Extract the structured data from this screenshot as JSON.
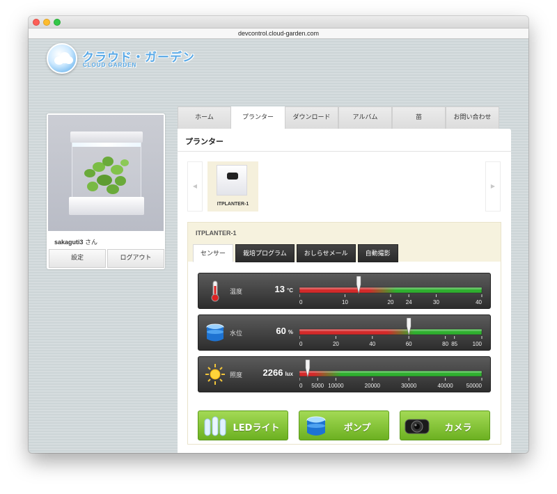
{
  "browser": {
    "url": "devcontrol.cloud-garden.com"
  },
  "logo": {
    "jp": "クラウド・ガーデン",
    "en": "CLOUD GARDEN"
  },
  "sidebar": {
    "username": "sakaguti3",
    "honorific": "さん",
    "settings_label": "設定",
    "logout_label": "ログアウト"
  },
  "nav": {
    "tabs": [
      {
        "label": "ホーム"
      },
      {
        "label": "プランター"
      },
      {
        "label": "ダウンロード"
      },
      {
        "label": "アルバム"
      },
      {
        "label": "苗"
      },
      {
        "label": "お問い合わせ"
      }
    ],
    "active": "プランター"
  },
  "panel": {
    "title": "プランター",
    "prev_arrow": "◀",
    "next_arrow": "▶",
    "planter_thumb_label": "ITPLANTER-1"
  },
  "device": {
    "name": "ITPLANTER-1",
    "subtabs": [
      {
        "label": "センサー"
      },
      {
        "label": "栽培プログラム"
      },
      {
        "label": "おしらせメール"
      },
      {
        "label": "自動撮影"
      }
    ],
    "sensors": [
      {
        "key": "temp",
        "label": "温度",
        "value": "13",
        "unit": "°C",
        "icon": "thermometer-icon",
        "min": 0,
        "max": 40,
        "reading": 13,
        "ticks": [
          0,
          10,
          20,
          24,
          30,
          40
        ],
        "green_from": 20
      },
      {
        "key": "water",
        "label": "水位",
        "value": "60",
        "unit": "%",
        "icon": "water-tank-icon",
        "min": 0,
        "max": 100,
        "reading": 60,
        "ticks": [
          0,
          20,
          40,
          60,
          80,
          85,
          100
        ],
        "green_from": 60
      },
      {
        "key": "light",
        "label": "照度",
        "value": "2266",
        "unit": "lux",
        "icon": "sun-icon",
        "min": 0,
        "max": 50000,
        "reading": 2266,
        "ticks": [
          0,
          5000,
          10000,
          20000,
          30000,
          40000,
          50000
        ],
        "green_from": 10000
      }
    ],
    "actions": [
      {
        "label": "LEDライト",
        "icon": "led-light-icon"
      },
      {
        "label": "ポンプ",
        "icon": "pump-icon"
      },
      {
        "label": "カメラ",
        "icon": "camera-icon"
      }
    ]
  },
  "colors": {
    "gauge_low": "#d42a2a",
    "gauge_high": "#2fb02f",
    "button_green": "#7fc236",
    "active_tab_bg": "#ffffff"
  }
}
